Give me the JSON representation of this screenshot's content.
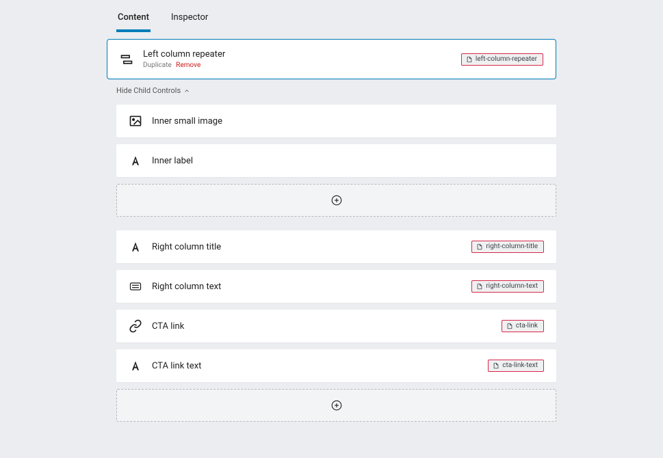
{
  "tabs": {
    "content": "Content",
    "inspector": "Inspector"
  },
  "hide_child_controls": "Hide Child Controls",
  "selected_block": {
    "title": "Left column repeater",
    "duplicate": "Duplicate",
    "remove": "Remove",
    "slug": "left-column-repeater"
  },
  "child_blocks": [
    {
      "title": "Inner small image"
    },
    {
      "title": "Inner label"
    }
  ],
  "sibling_blocks": [
    {
      "title": "Right column title",
      "slug": "right-column-title"
    },
    {
      "title": "Right column text",
      "slug": "right-column-text"
    },
    {
      "title": "CTA link",
      "slug": "cta-link"
    },
    {
      "title": "CTA link text",
      "slug": "cta-link-text"
    }
  ]
}
